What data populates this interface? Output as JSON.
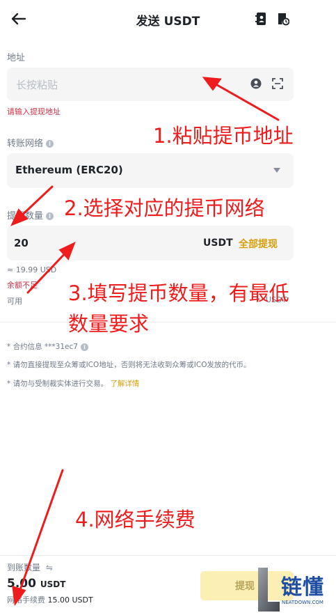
{
  "header": {
    "title": "发送 USDT",
    "back_icon": "arrow-left-icon",
    "icons": [
      "address-book-icon",
      "history-icon"
    ]
  },
  "address": {
    "label": "地址",
    "placeholder": "长按粘贴",
    "error": "请输入提现地址",
    "icons": [
      "contact-icon",
      "scan-icon"
    ]
  },
  "network": {
    "label": "转账网络",
    "value": "Ethereum (ERC20)"
  },
  "amount": {
    "label": "提现数量",
    "value": "20",
    "unit": "USDT",
    "all_label": "全部提现",
    "approx": "≈ 19.99 USD",
    "error": "余额不足",
    "available_label": "可用",
    "available_unit": "USDT"
  },
  "notes": {
    "contract": "* 合约信息 ***31ec7",
    "warning1": "* 请勿直接提现至众筹或ICO地址，否则将无法收到众筹或ICO发放的代币。",
    "warning2": "* 请勿与受制裁实体进行交易。",
    "learn_more": "了解详情"
  },
  "footer": {
    "receive_label": "到账数量",
    "receive_amount": "5.00",
    "receive_unit": "USDT",
    "fee_label": "网络手续费",
    "fee_value": "15.00 USDT",
    "submit_label": "提现"
  },
  "annotations": {
    "a1": "1.粘贴提币地址",
    "a2": "2.选择对应的提币网络",
    "a3_line1": "3.填写提币数量，有最低",
    "a3_line2": "数量要求",
    "a4": "4.网络手续费"
  },
  "watermark": {
    "text": "链懂",
    "sub": "NEATDOWN.COM"
  },
  "colors": {
    "accent": "#d89f0e",
    "error": "#cf304a",
    "annotation": "#ee1c1c",
    "button_disabled": "#fcefb4"
  }
}
